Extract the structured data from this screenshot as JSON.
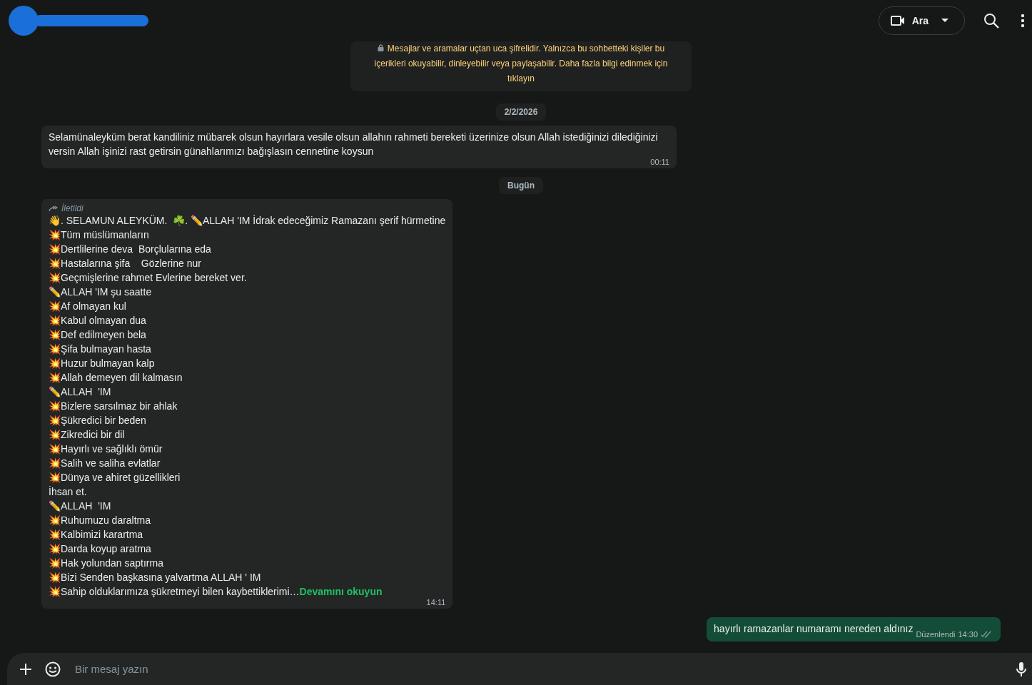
{
  "header": {
    "call_button": {
      "label": "Ara"
    }
  },
  "encryption_notice": {
    "text": "Mesajlar ve aramalar uçtan uca şifrelidir. Yalnızca bu sohbetteki kişiler bu içerikleri okuyabilir, dinleyebilir veya paylaşabilir. Daha fazla bilgi edinmek için tıklayın"
  },
  "messages": [
    {
      "kind": "date",
      "text": "2/2/2026"
    },
    {
      "kind": "incoming",
      "forwarded": false,
      "lines": [
        "Selamünaleyküm berat kandiliniz mübarek olsun hayırlara vesile olsun allahın rahmeti bereketi üzerinize olsun Allah istediğinizi dilediğinizi versin Allah işinizi rast getirsin günahlarımızı bağışlasın cennetine koysun"
      ],
      "time": "00:11"
    },
    {
      "kind": "date",
      "text": "Bugün"
    },
    {
      "kind": "incoming",
      "forwarded": true,
      "forwarded_label": "İletildi",
      "lines": [
        "👋. SELAMUN ALEYKÜM.  ☘️. ✏️ALLAH 'IM İdrak edeceğimiz Ramazanı şerif hürmetine",
        "💥Tüm müslümanların",
        "💥Dertlilerine deva  Borçlularına eda",
        "💥Hastalarına şifa    Gözlerine nur",
        "💥Geçmişlerine rahmet Evlerine bereket ver.",
        "✏️ALLAH 'IM şu saatte",
        "💥Af olmayan kul",
        "💥Kabul olmayan dua",
        "💥Def edilmeyen bela",
        "💥Şifa bulmayan hasta",
        "💥Huzur bulmayan kalp",
        "💥Allah demeyen dil kalmasın",
        "✏️ALLAH  'IM",
        "💥Bizlere sarsılmaz bir ahlak",
        "💥Şükredici bir beden",
        "💥Zikredici bir dil",
        "💥Hayırlı ve sağlıklı ömür",
        "💥Salih ve saliha evlatlar",
        "💥Dünya ve ahiret güzellikleri",
        "İhsan et.",
        "✏️ALLAH  'IM",
        "💥Ruhumuzu daraltma",
        "💥Kalbimizi karartma",
        "💥Darda koyup aratma",
        "💥Hak yolundan saptırma",
        "💥Bizi Senden başkasına yalvartma ALLAH ' IM",
        "💥Sahip olduklarımıza şükretmeyi bilen kaybettiklerimi…"
      ],
      "read_more": "Devamını okuyun",
      "time": "14:11"
    },
    {
      "kind": "outgoing",
      "lines": [
        "hayırlı ramazanlar numaramı nereden aldınız"
      ],
      "edited_label": "Düzenlendi",
      "time": "14:30",
      "read": false
    }
  ],
  "composer": {
    "placeholder": "Bir mesaj yazın"
  }
}
